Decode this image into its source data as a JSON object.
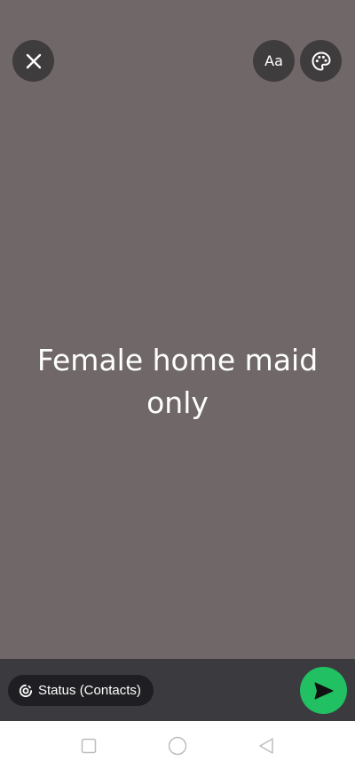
{
  "status": {
    "text_lines": [
      "Female home maid",
      "only"
    ],
    "background_color": "#706868"
  },
  "toolbar": {
    "close_icon": "close-icon",
    "font_label": "Aa",
    "palette_icon": "palette-icon"
  },
  "composer": {
    "audience_label": "Status (Contacts)",
    "audience_icon": "status-icon",
    "send_icon": "send-icon",
    "send_color": "#21c063"
  },
  "nav": {
    "recents_icon": "square-icon",
    "home_icon": "circle-icon",
    "back_icon": "triangle-back-icon"
  }
}
